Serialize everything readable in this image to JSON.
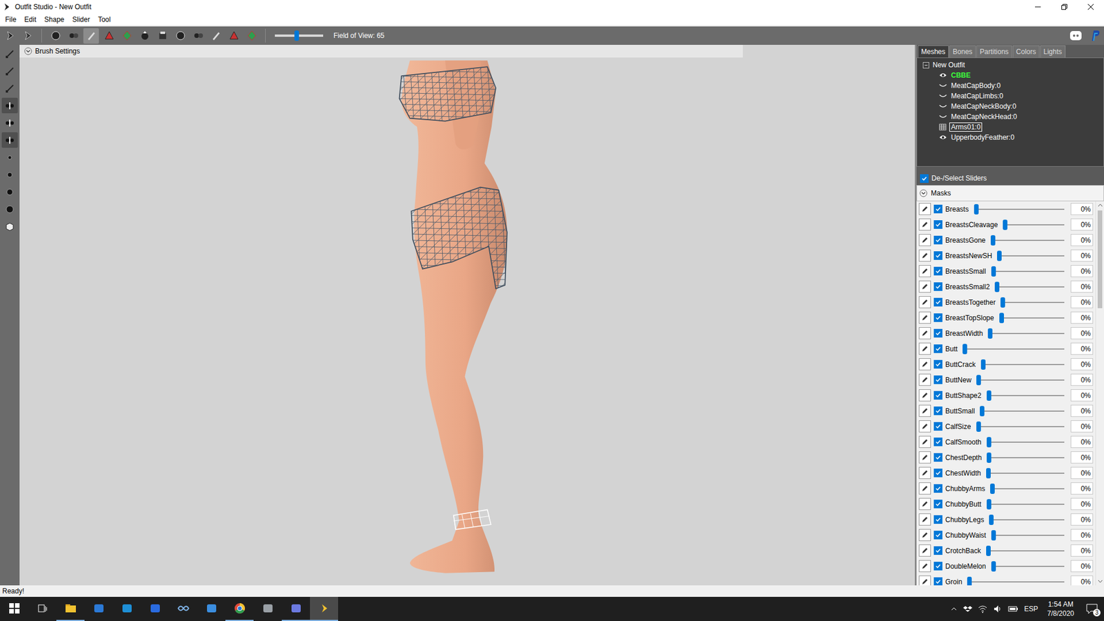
{
  "window": {
    "title": "Outfit Studio - New Outfit"
  },
  "menu": [
    "File",
    "Edit",
    "Shape",
    "Slider",
    "Tool"
  ],
  "toolbar": {
    "tools": [
      {
        "selected": false
      },
      {
        "selected": false
      },
      {
        "selected": false
      },
      {
        "selected": false
      },
      {
        "selected": true
      },
      {
        "selected": false
      },
      {
        "selected": false
      },
      {
        "selected": false
      },
      {
        "selected": false
      },
      {
        "selected": false
      },
      {
        "selected": false
      },
      {
        "selected": false
      },
      {
        "selected": false
      },
      {
        "selected": false
      }
    ],
    "field_of_view": {
      "label": "Field of View: 65",
      "level": 0.45
    }
  },
  "left_toolbar": [
    {
      "selected": false
    },
    {
      "selected": false
    },
    {
      "selected": false
    },
    {
      "selected": true
    },
    {
      "selected": false
    },
    {
      "selected": true
    },
    {
      "selected": false
    },
    {
      "selected": false
    },
    {
      "selected": false
    },
    {
      "selected": false
    },
    {
      "selected": false
    }
  ],
  "viewport": {
    "brush_settings": {
      "label": "Brush Settings",
      "expanded": false
    }
  },
  "panel": {
    "tabs": [
      {
        "label": "Meshes",
        "selected": true
      },
      {
        "label": "Bones",
        "selected": false
      },
      {
        "label": "Partitions",
        "selected": false
      },
      {
        "label": "Colors",
        "selected": false
      },
      {
        "label": "Lights",
        "selected": false
      }
    ],
    "tree": {
      "root": {
        "label": "New Outfit",
        "expanded": true
      },
      "items": [
        {
          "label": "CBBE",
          "kind": "visible",
          "selected": false,
          "color": "#3cff3c"
        },
        {
          "label": "MeatCapBody:0",
          "kind": "hidden",
          "selected": false,
          "color": "#ffffff"
        },
        {
          "label": "MeatCapLimbs:0",
          "kind": "hidden",
          "selected": false,
          "color": "#ffffff"
        },
        {
          "label": "MeatCapNeckBody:0",
          "kind": "hidden",
          "selected": false,
          "color": "#ffffff"
        },
        {
          "label": "MeatCapNeckHead:0",
          "kind": "hidden",
          "selected": false,
          "color": "#ffffff"
        },
        {
          "label": "Arms01:0",
          "kind": "wireframe",
          "selected": true,
          "color": "#ffffff"
        },
        {
          "label": "UpperbodyFeather:0",
          "kind": "visible",
          "selected": false,
          "color": "#ffffff"
        }
      ]
    },
    "deselect_sliders": {
      "label": "De-/Select Sliders",
      "checked": true
    },
    "masks": {
      "label": "Masks",
      "expanded": false
    },
    "sliders": [
      {
        "name": "Breasts",
        "checked": true,
        "level": 0,
        "reading": "0%"
      },
      {
        "name": "BreastsCleavage",
        "checked": true,
        "level": 0,
        "reading": "0%"
      },
      {
        "name": "BreastsGone",
        "checked": true,
        "level": 0,
        "reading": "0%"
      },
      {
        "name": "BreastsNewSH",
        "checked": true,
        "level": 0,
        "reading": "0%"
      },
      {
        "name": "BreastsSmall",
        "checked": true,
        "level": 0,
        "reading": "0%"
      },
      {
        "name": "BreastsSmall2",
        "checked": true,
        "level": 0,
        "reading": "0%"
      },
      {
        "name": "BreastsTogether",
        "checked": true,
        "level": 0,
        "reading": "0%"
      },
      {
        "name": "BreastTopSlope",
        "checked": true,
        "level": 0,
        "reading": "0%"
      },
      {
        "name": "BreastWidth",
        "checked": true,
        "level": 0,
        "reading": "0%"
      },
      {
        "name": "Butt",
        "checked": true,
        "level": 0,
        "reading": "0%"
      },
      {
        "name": "ButtCrack",
        "checked": true,
        "level": 0,
        "reading": "0%"
      },
      {
        "name": "ButtNew",
        "checked": true,
        "level": 0,
        "reading": "0%"
      },
      {
        "name": "ButtShape2",
        "checked": true,
        "level": 0,
        "reading": "0%"
      },
      {
        "name": "ButtSmall",
        "checked": true,
        "level": 0,
        "reading": "0%"
      },
      {
        "name": "CalfSize",
        "checked": true,
        "level": 0,
        "reading": "0%"
      },
      {
        "name": "CalfSmooth",
        "checked": true,
        "level": 0,
        "reading": "0%"
      },
      {
        "name": "ChestDepth",
        "checked": true,
        "level": 0,
        "reading": "0%"
      },
      {
        "name": "ChestWidth",
        "checked": true,
        "level": 0,
        "reading": "0%"
      },
      {
        "name": "ChubbyArms",
        "checked": true,
        "level": 0,
        "reading": "0%"
      },
      {
        "name": "ChubbyButt",
        "checked": true,
        "level": 0,
        "reading": "0%"
      },
      {
        "name": "ChubbyLegs",
        "checked": true,
        "level": 0,
        "reading": "0%"
      },
      {
        "name": "ChubbyWaist",
        "checked": true,
        "level": 0,
        "reading": "0%"
      },
      {
        "name": "CrotchBack",
        "checked": true,
        "level": 0,
        "reading": "0%"
      },
      {
        "name": "DoubleMelon",
        "checked": true,
        "level": 0,
        "reading": "0%"
      },
      {
        "name": "Groin",
        "checked": true,
        "level": 0,
        "reading": "0%"
      }
    ]
  },
  "status_bar": "Ready!",
  "taskbar": {
    "apps": [
      {
        "active": true,
        "selected": false
      },
      {
        "active": false,
        "selected": false
      },
      {
        "active": false,
        "selected": false
      },
      {
        "active": false,
        "selected": false
      },
      {
        "active": false,
        "selected": false
      },
      {
        "active": false,
        "selected": false
      },
      {
        "active": true,
        "selected": false
      },
      {
        "active": false,
        "selected": false
      },
      {
        "active": true,
        "selected": false
      },
      {
        "active": true,
        "selected": true
      }
    ],
    "tray": {
      "language": "ESP",
      "time": "1:54 AM",
      "date": "7/8/2020",
      "notifications": "3"
    }
  }
}
